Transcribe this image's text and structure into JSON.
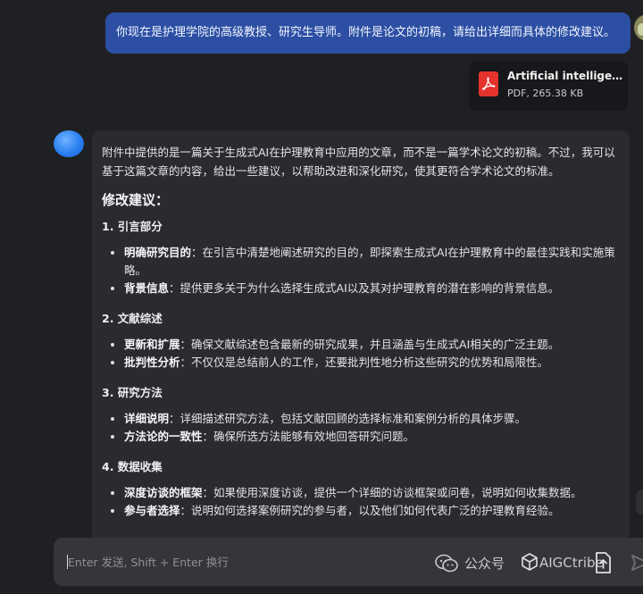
{
  "user_message": "你现在是护理学院的高级教授、研究生导师。附件是论文的初稿，请给出详细而具体的修改建议。",
  "attachment": {
    "name": "Artificial intelligence ...",
    "meta": "PDF, 265.38 KB"
  },
  "reply": {
    "intro": "附件中提供的是一篇关于生成式AI在护理教育中应用的文章，而不是一篇学术论文的初稿。不过，我可以基于这篇文章的内容，给出一些建议，以帮助改进和深化研究，使其更符合学术论文的标准。",
    "heading": "修改建议：",
    "sections": [
      {
        "title": "1. 引言部分",
        "items": [
          {
            "label": "明确研究目的",
            "text": "：在引言中清楚地阐述研究的目的，即探索生成式AI在护理教育中的最佳实践和实施策略。"
          },
          {
            "label": "背景信息",
            "text": "：提供更多关于为什么选择生成式AI以及其对护理教育的潜在影响的背景信息。"
          }
        ]
      },
      {
        "title": "2. 文献综述",
        "items": [
          {
            "label": "更新和扩展",
            "text": "：确保文献综述包含最新的研究成果，并且涵盖与生成式AI相关的广泛主题。"
          },
          {
            "label": "批判性分析",
            "text": "：不仅仅是总结前人的工作，还要批判性地分析这些研究的优势和局限性。"
          }
        ]
      },
      {
        "title": "3. 研究方法",
        "items": [
          {
            "label": "详细说明",
            "text": "：详细描述研究方法，包括文献回顾的选择标准和案例分析的具体步骤。"
          },
          {
            "label": "方法论的一致性",
            "text": "：确保所选方法能够有效地回答研究问题。"
          }
        ]
      },
      {
        "title": "4. 数据收集",
        "items": [
          {
            "label": "深度访谈的框架",
            "text": "：如果使用深度访谈，提供一个详细的访谈框架或问卷，说明如何收集数据。"
          },
          {
            "label": "参与者选择",
            "text": "：说明如何选择案例研究的参与者，以及他们如何代表广泛的护理教育经验。"
          }
        ]
      }
    ]
  },
  "input": {
    "placeholder": "Enter 发送, Shift + Enter 换行"
  },
  "watermark": {
    "prefix": "公众号",
    "name": "AIGCtribe"
  },
  "colors": {
    "background": "#1f2023",
    "user_bubble": "#2c4fa3",
    "bot_bubble": "#2a2b2f",
    "input_bar": "#35363a",
    "pdf_red": "#e5322d"
  }
}
